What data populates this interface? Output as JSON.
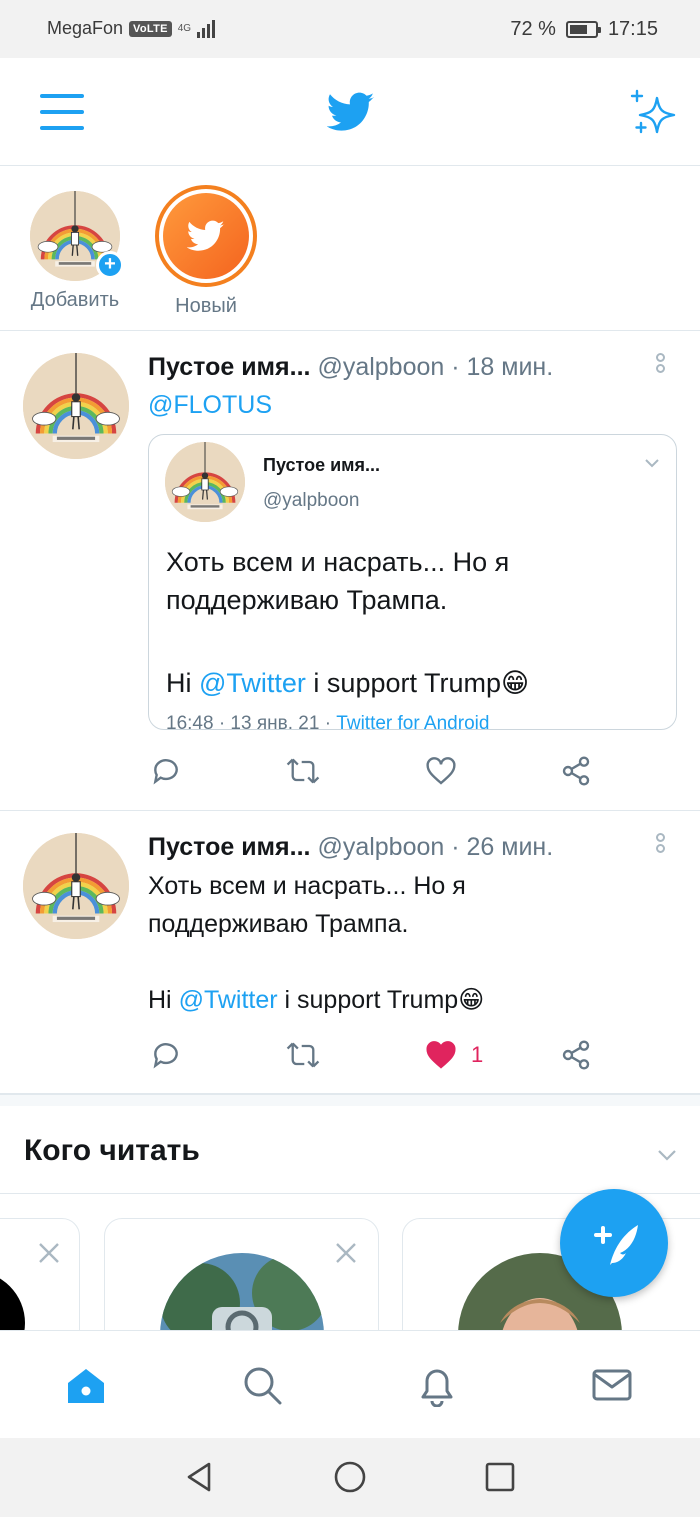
{
  "status_bar": {
    "carrier": "MegaFon",
    "volte": "VoLTE",
    "network": "4G",
    "battery_percent": "72 %",
    "battery_level": 0.72,
    "time": "17:15"
  },
  "header": {
    "menu_icon": "hamburger-icon",
    "logo_icon": "twitter-bird-icon",
    "sparkle_icon": "sparkle-icon"
  },
  "fleets": [
    {
      "label": "Добавить",
      "icon": "plus-icon"
    },
    {
      "label": "Новый",
      "icon": "twitter-bird-icon"
    }
  ],
  "tweets": [
    {
      "name": "Пустое имя...",
      "handle_time": "@yalpboon · 18 мин.",
      "reply_to": "@FLOTUS",
      "quote": {
        "name": "Пустое имя...",
        "handle": "@yalpboon",
        "line1": "Хоть всем и насрать... Но я",
        "line2": "поддерживаю Трампа.",
        "line3_pre": "Hi ",
        "line3_mention": "@Twitter",
        "line3_post": " i support Trump😁",
        "meta": "16:48 · 13 янв. 21 · ",
        "source": "Twitter for Android"
      },
      "liked": false,
      "like_count": ""
    },
    {
      "name": "Пустое имя...",
      "handle_time": "@yalpboon · 26 мин.",
      "line1": "Хоть всем и насрать... Но я",
      "line2": "поддерживаю Трампа.",
      "line3_pre": "Hi ",
      "line3_mention": "@Twitter",
      "line3_post": " i support Trump😁",
      "liked": true,
      "like_count": "1"
    }
  ],
  "who_to_follow": {
    "title": "Кого читать"
  },
  "colors": {
    "accent": "#1da1f2",
    "like": "#e0245e",
    "secondary_text": "#657786",
    "fleet_ring": "#f4801f"
  }
}
